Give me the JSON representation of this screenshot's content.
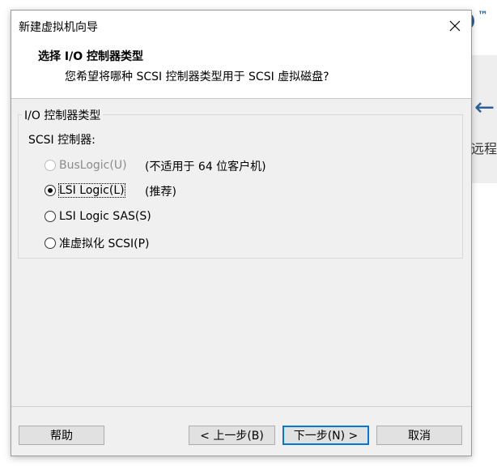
{
  "window": {
    "title": "新建虚拟机向导"
  },
  "header": {
    "title": "选择 I/O 控制器类型",
    "subtitle": "您希望将哪种 SCSI 控制器类型用于 SCSI 虚拟磁盘?"
  },
  "group": {
    "legend": "I/O 控制器类型",
    "scsi_label": "SCSI 控制器:",
    "options": [
      {
        "label": "BusLogic(U)",
        "note": "(不适用于 64 位客户机)",
        "checked": false,
        "disabled": true
      },
      {
        "label": "LSI Logic(L)",
        "note": "(推荐)",
        "checked": true,
        "disabled": false
      },
      {
        "label": "LSI Logic SAS(S)",
        "note": "",
        "checked": false,
        "disabled": false
      },
      {
        "label": "准虚拟化 SCSI(P)",
        "note": "",
        "checked": false,
        "disabled": false
      }
    ]
  },
  "buttons": {
    "help": "帮助",
    "back": "< 上一步(B)",
    "next": "下一步(N) >",
    "cancel": "取消"
  },
  "background": {
    "partial_text": "远程"
  },
  "colors": {
    "accent": "#0078d7",
    "dialog_bg": "#f0f0f0"
  }
}
